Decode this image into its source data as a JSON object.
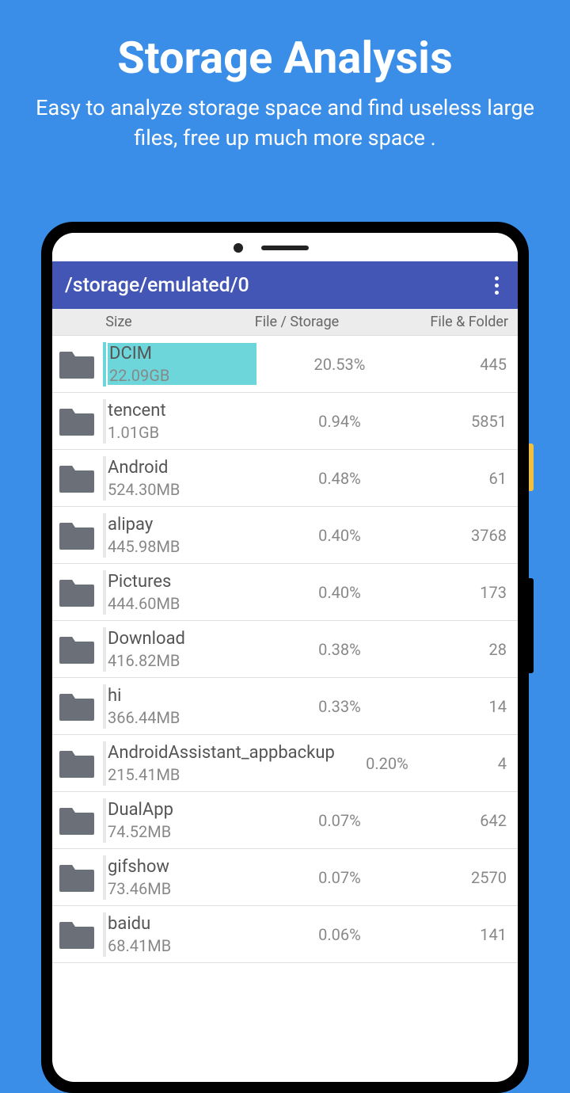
{
  "promo": {
    "title": "Storage Analysis",
    "subtitle": "Easy to analyze storage space and find useless large files, free up much more space ."
  },
  "appbar": {
    "path": "/storage/emulated/0"
  },
  "columns": {
    "size": "Size",
    "ratio": "File / Storage",
    "count": "File & Folder"
  },
  "items": [
    {
      "name": "DCIM",
      "size": "22.09GB",
      "pct": "20.53%",
      "count": "445",
      "highlight": true
    },
    {
      "name": "tencent",
      "size": "1.01GB",
      "pct": "0.94%",
      "count": "5851",
      "highlight": false
    },
    {
      "name": "Android",
      "size": "524.30MB",
      "pct": "0.48%",
      "count": "61",
      "highlight": false
    },
    {
      "name": "alipay",
      "size": "445.98MB",
      "pct": "0.40%",
      "count": "3768",
      "highlight": false
    },
    {
      "name": "Pictures",
      "size": "444.60MB",
      "pct": "0.40%",
      "count": "173",
      "highlight": false
    },
    {
      "name": "Download",
      "size": "416.82MB",
      "pct": "0.38%",
      "count": "28",
      "highlight": false
    },
    {
      "name": "hi",
      "size": "366.44MB",
      "pct": "0.33%",
      "count": "14",
      "highlight": false
    },
    {
      "name": "AndroidAssistant_appbackup",
      "size": "215.41MB",
      "pct": "0.20%",
      "count": "4",
      "highlight": false,
      "wide": true
    },
    {
      "name": "DualApp",
      "size": "74.52MB",
      "pct": "0.07%",
      "count": "642",
      "highlight": false
    },
    {
      "name": "gifshow",
      "size": "73.46MB",
      "pct": "0.07%",
      "count": "2570",
      "highlight": false
    },
    {
      "name": "baidu",
      "size": "68.41MB",
      "pct": "0.06%",
      "count": "141",
      "highlight": false
    }
  ]
}
